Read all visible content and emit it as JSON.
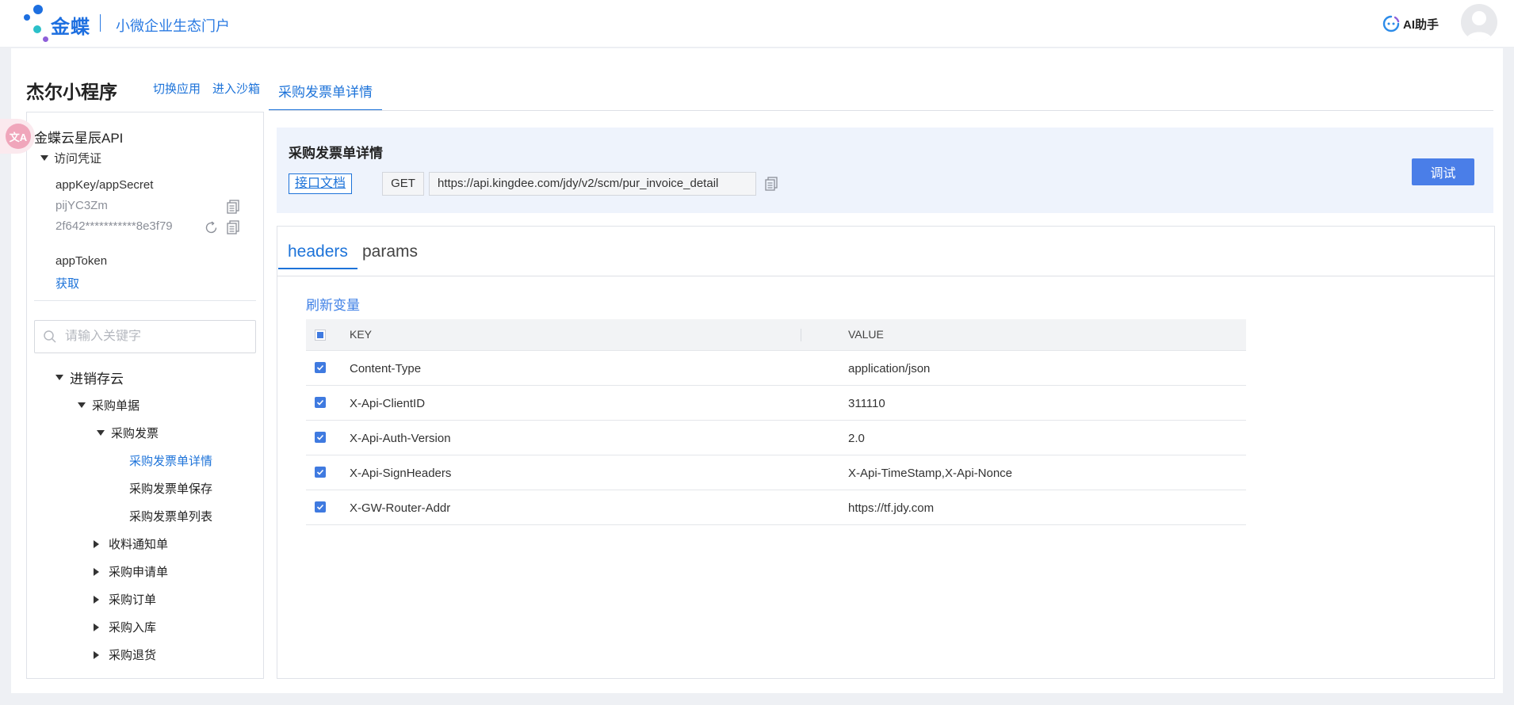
{
  "topbar": {
    "brand": "金蝶",
    "subtitle": "小微企业生态门户",
    "ai_helper": "AI助手"
  },
  "header": {
    "app_title": "杰尔小程序",
    "switch_app": "切换应用",
    "enter_sandbox": "进入沙箱",
    "active_tab": "采购发票单详情"
  },
  "sidebar": {
    "title": "金蝶云星辰API",
    "credentials_label": "访问凭证",
    "appkey_label": "appKey/appSecret",
    "appkey_value": "pijYC3Zm",
    "appsecret_value": "2f642***********8e3f79",
    "apptoken_label": "appToken",
    "get_link": "获取",
    "search_placeholder": "请输入关键字",
    "tree": {
      "root": "进销存云",
      "group": "采购单据",
      "subgroup": "采购发票",
      "leaf_1": "采购发票单详情",
      "leaf_2": "采购发票单保存",
      "leaf_3": "采购发票单列表",
      "sibling_1": "收料通知单",
      "sibling_2": "采购申请单",
      "sibling_3": "采购订单",
      "sibling_4": "采购入库",
      "sibling_5": "采购退货"
    }
  },
  "api": {
    "title": "采购发票单详情",
    "doc_button": "接口文档",
    "method": "GET",
    "url": "https://api.kingdee.com/jdy/v2/scm/pur_invoice_detail",
    "debug_button": "调试"
  },
  "panel": {
    "tabs": [
      "headers",
      "params"
    ],
    "refresh_link": "刷新变量",
    "columns": [
      "KEY",
      "VALUE"
    ],
    "rows": [
      {
        "key": "Content-Type",
        "value": "application/json"
      },
      {
        "key": "X-Api-ClientID",
        "value": "311110"
      },
      {
        "key": "X-Api-Auth-Version",
        "value": "2.0"
      },
      {
        "key": "X-Api-SignHeaders",
        "value": "X-Api-TimeStamp,X-Api-Nonce"
      },
      {
        "key": "X-GW-Router-Addr",
        "value": "https://tf.jdy.com"
      }
    ]
  },
  "colors": {
    "accent": "#1d73d9",
    "button": "#4a7ee8",
    "api_head_bg": "#eef3fc"
  }
}
